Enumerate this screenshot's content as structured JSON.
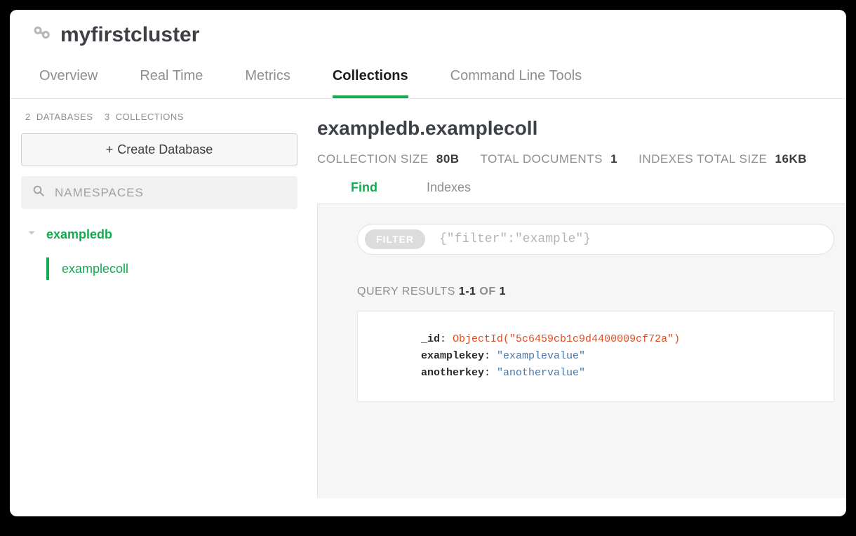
{
  "header": {
    "cluster_name": "myfirstcluster"
  },
  "tabs": [
    {
      "label": "Overview",
      "active": false
    },
    {
      "label": "Real Time",
      "active": false
    },
    {
      "label": "Metrics",
      "active": false
    },
    {
      "label": "Collections",
      "active": true
    },
    {
      "label": "Command Line Tools",
      "active": false
    }
  ],
  "sidebar": {
    "stats": {
      "db_count": "2",
      "db_label": "DATABASES",
      "coll_count": "3",
      "coll_label": "COLLECTIONS"
    },
    "create_db_label": "Create Database",
    "namespaces_label": "NAMESPACES",
    "database": {
      "name": "exampledb",
      "collection": "examplecoll"
    }
  },
  "main": {
    "namespace_title": "exampledb.examplecoll",
    "metrics": {
      "coll_size_label": "COLLECTION SIZE",
      "coll_size_value": "80B",
      "total_docs_label": "TOTAL DOCUMENTS",
      "total_docs_value": "1",
      "indexes_size_label": "INDEXES TOTAL SIZE",
      "indexes_size_value": "16KB"
    },
    "subtabs": {
      "find": "Find",
      "indexes": "Indexes"
    },
    "filter": {
      "pill": "FILTER",
      "placeholder": "{\"filter\":\"example\"}"
    },
    "query_results": {
      "label": "QUERY RESULTS",
      "range": "1-1",
      "of": "OF",
      "total": "1"
    },
    "document": {
      "id_key": "_id",
      "id_value": "ObjectId(\"5c6459cb1c9d4400009cf72a\")",
      "k1": "examplekey",
      "v1": "\"examplevalue\"",
      "k2": "anotherkey",
      "v2": "\"anothervalue\""
    }
  }
}
